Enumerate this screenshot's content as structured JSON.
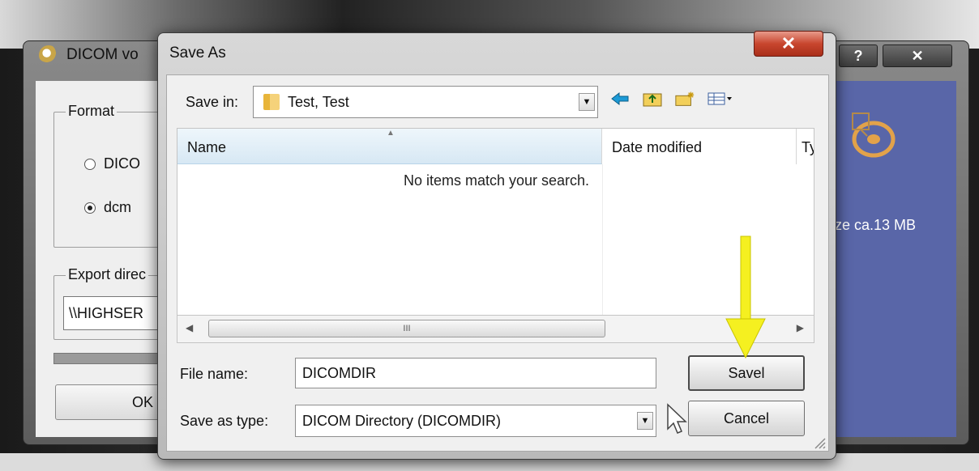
{
  "background_window": {
    "title": "DICOM vo",
    "help_button": "?",
    "close_button": "✕",
    "format_legend": "Format",
    "radio_dicomdir": "DICO",
    "radio_dcm": "dcm",
    "export_legend": "Export direc",
    "export_path": "\\\\HIGHSER",
    "ok_label": "OK",
    "size_label": "ze ca.13 MB"
  },
  "dialog": {
    "title": "Save As",
    "close_label": "✕",
    "save_in_label": "Save in:",
    "save_in_value": "Test, Test",
    "columns": [
      "Name",
      "Date modified",
      "Ty"
    ],
    "empty_message": "No items match your search.",
    "scroll_thumb_label": "III",
    "file_name_label": "File name:",
    "file_name_value": "DICOMDIR",
    "save_type_label": "Save as type:",
    "save_type_value": "DICOM Directory (DICOMDIR)",
    "save_button": "Savel",
    "cancel_button": "Cancel",
    "toolbar": [
      "back-arrow-icon",
      "up-folder-icon",
      "new-folder-icon",
      "view-menu-icon"
    ]
  },
  "colors": {
    "annotation_arrow": "#f5f020",
    "background_panel": "#5966a8",
    "close_button": "#c8462e"
  }
}
